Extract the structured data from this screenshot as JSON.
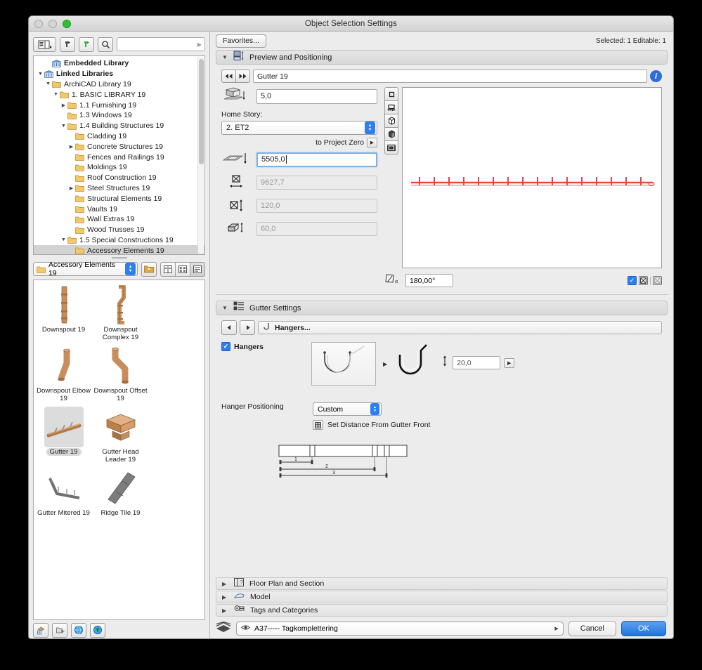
{
  "window": {
    "title": "Object Selection Settings"
  },
  "library": {
    "search_placeholder": "",
    "search_value": "",
    "tree": [
      {
        "label": "Embedded Library",
        "depth": 1,
        "twisty": "",
        "icon": "bank",
        "bold": true,
        "selected": false
      },
      {
        "label": "Linked Libraries",
        "depth": 0,
        "twisty": "▼",
        "icon": "bank",
        "bold": true,
        "selected": false
      },
      {
        "label": "ArchiCAD Library 19",
        "depth": 1,
        "twisty": "▼",
        "icon": "folder",
        "bold": false,
        "selected": false
      },
      {
        "label": "1. BASIC LIBRARY 19",
        "depth": 2,
        "twisty": "▼",
        "icon": "folder",
        "bold": false,
        "selected": false
      },
      {
        "label": "1.1 Furnishing 19",
        "depth": 3,
        "twisty": "▶",
        "icon": "folder",
        "bold": false,
        "selected": false
      },
      {
        "label": "1.3 Windows 19",
        "depth": 3,
        "twisty": "",
        "icon": "folder",
        "bold": false,
        "selected": false
      },
      {
        "label": "1.4 Building Structures 19",
        "depth": 3,
        "twisty": "▼",
        "icon": "folder",
        "bold": false,
        "selected": false
      },
      {
        "label": "Cladding 19",
        "depth": 4,
        "twisty": "",
        "icon": "folder",
        "bold": false,
        "selected": false
      },
      {
        "label": "Concrete Structures 19",
        "depth": 4,
        "twisty": "▶",
        "icon": "folder",
        "bold": false,
        "selected": false
      },
      {
        "label": "Fences and Railings 19",
        "depth": 4,
        "twisty": "",
        "icon": "folder",
        "bold": false,
        "selected": false
      },
      {
        "label": "Moldings 19",
        "depth": 4,
        "twisty": "",
        "icon": "folder",
        "bold": false,
        "selected": false
      },
      {
        "label": "Roof Construction 19",
        "depth": 4,
        "twisty": "",
        "icon": "folder",
        "bold": false,
        "selected": false
      },
      {
        "label": "Steel Structures 19",
        "depth": 4,
        "twisty": "▶",
        "icon": "folder",
        "bold": false,
        "selected": false
      },
      {
        "label": "Structural Elements 19",
        "depth": 4,
        "twisty": "",
        "icon": "folder",
        "bold": false,
        "selected": false
      },
      {
        "label": "Vaults 19",
        "depth": 4,
        "twisty": "",
        "icon": "folder",
        "bold": false,
        "selected": false
      },
      {
        "label": "Wall Extras 19",
        "depth": 4,
        "twisty": "",
        "icon": "folder",
        "bold": false,
        "selected": false
      },
      {
        "label": "Wood Trusses 19",
        "depth": 4,
        "twisty": "",
        "icon": "folder",
        "bold": false,
        "selected": false
      },
      {
        "label": "1.5 Special Constructions 19",
        "depth": 3,
        "twisty": "▼",
        "icon": "folder",
        "bold": false,
        "selected": false
      },
      {
        "label": "Accessory Elements 19",
        "depth": 4,
        "twisty": "",
        "icon": "folder",
        "bold": false,
        "selected": true
      }
    ],
    "current_folder": "Accessory Elements 19",
    "objects": [
      {
        "name": "Downspout 19",
        "selected": false,
        "shape": "downspout"
      },
      {
        "name": "Downspout Complex 19",
        "selected": false,
        "shape": "downspout-complex"
      },
      {
        "name": "Downspout Elbow 19",
        "selected": false,
        "shape": "downspout-elbow"
      },
      {
        "name": "Downspout Offset 19",
        "selected": false,
        "shape": "downspout-offset"
      },
      {
        "name": "Gutter 19",
        "selected": true,
        "shape": "gutter"
      },
      {
        "name": "Gutter Head Leader 19",
        "selected": false,
        "shape": "gutter-head"
      },
      {
        "name": "Gutter Mitered 19",
        "selected": false,
        "shape": "gutter-mitered"
      },
      {
        "name": "Ridge Tile 19",
        "selected": false,
        "shape": "ridge-tile"
      }
    ]
  },
  "header": {
    "favorites_label": "Favorites...",
    "selection_info": "Selected: 1 Editable: 1"
  },
  "preview_section": {
    "title": "Preview and Positioning",
    "object_name": "Gutter 19",
    "elevation_value": "5,0",
    "home_story_label": "Home Story:",
    "home_story_value": "2. ET2",
    "to_project_zero_label": "to Project Zero",
    "project_zero_value": "5505,0",
    "width_value": "9627,7",
    "height_value": "120,0",
    "depth_value": "60,0",
    "angle_value": "180,00°"
  },
  "gutter_section": {
    "title": "Gutter Settings",
    "tab_label": "Hangers...",
    "hangers_checkbox_label": "Hangers",
    "hangers_checked": true,
    "hanger_distance": "20,0",
    "hanger_positioning_label": "Hanger Positioning",
    "hanger_positioning_value": "Custom",
    "set_distance_label": "Set Distance From Gutter Front",
    "diagram_labels": [
      "1",
      "2",
      "3"
    ]
  },
  "collapsed_sections": [
    {
      "label": "Floor Plan and Section",
      "icon": "floorplan-icon"
    },
    {
      "label": "Model",
      "icon": "model-icon"
    },
    {
      "label": "Tags and Categories",
      "icon": "tags-icon"
    }
  ],
  "footer": {
    "layer_value": "A37----- Tagkomplettering",
    "cancel_label": "Cancel",
    "ok_label": "OK"
  },
  "colors": {
    "accent": "#2d7ff0",
    "ok_button": "#1f72e0",
    "preview_line": "#e8463c",
    "window_bg": "#ececec"
  }
}
